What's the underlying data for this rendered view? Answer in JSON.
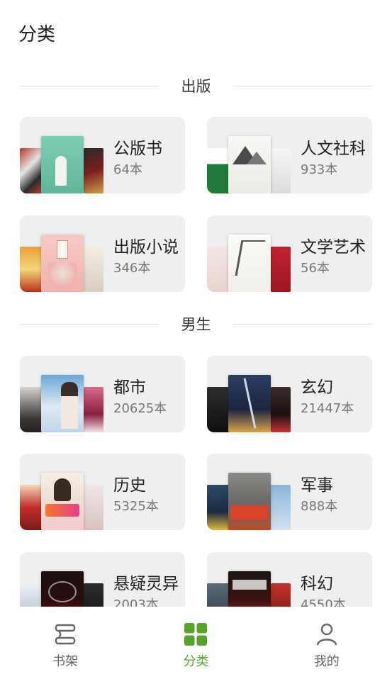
{
  "page": {
    "title": "分类"
  },
  "sections": {
    "publish": {
      "title": "出版"
    },
    "male": {
      "title": "男生"
    }
  },
  "categories": {
    "gongban": {
      "name": "公版书",
      "count": "64本",
      "icon": "book-covers-icon"
    },
    "renwen": {
      "name": "人文社科",
      "count": "933本",
      "icon": "book-covers-icon"
    },
    "chubanxiaoshuo": {
      "name": "出版小说",
      "count": "346本",
      "icon": "book-covers-icon"
    },
    "wenxue": {
      "name": "文学艺术",
      "count": "56本",
      "icon": "book-covers-icon"
    },
    "dushi": {
      "name": "都市",
      "count": "20625本",
      "icon": "book-covers-icon"
    },
    "xuanhuan": {
      "name": "玄幻",
      "count": "21447本",
      "icon": "book-covers-icon"
    },
    "lishi": {
      "name": "历史",
      "count": "5325本",
      "icon": "book-covers-icon"
    },
    "junshi": {
      "name": "军事",
      "count": "888本",
      "icon": "book-covers-icon"
    },
    "xuanyi": {
      "name": "悬疑灵异",
      "count": "2003本",
      "icon": "book-covers-icon"
    },
    "kehuan": {
      "name": "科幻",
      "count": "4550本",
      "icon": "book-covers-icon"
    }
  },
  "tabs": [
    {
      "label": "书架",
      "icon": "bookshelf-icon",
      "active": false
    },
    {
      "label": "分类",
      "icon": "grid-icon",
      "active": true
    },
    {
      "label": "我的",
      "icon": "user-icon",
      "active": false
    }
  ],
  "colors": {
    "accent": "#56a52a",
    "card_bg": "#efefef",
    "divider": "#e3e3e3"
  }
}
